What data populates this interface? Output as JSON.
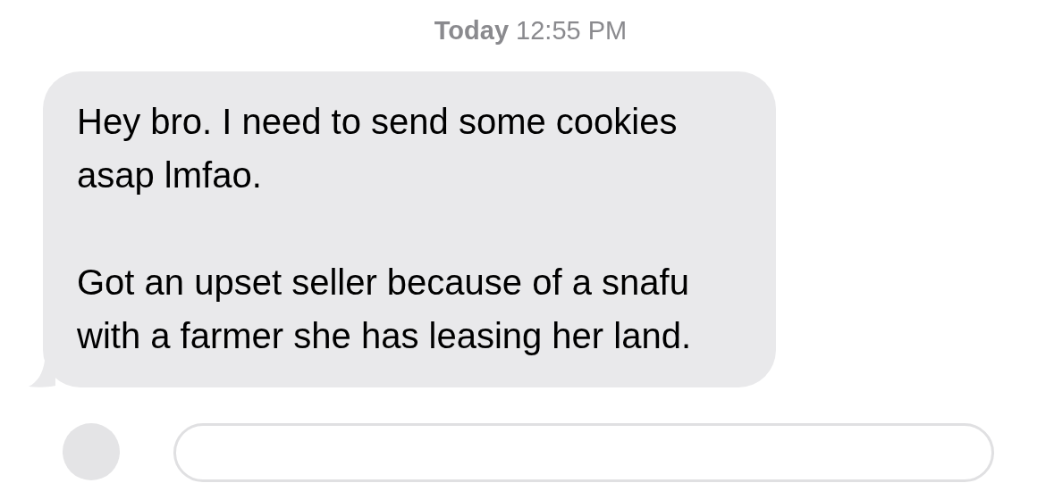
{
  "timestamp": "**Today** 12:55 PM",
  "message": {
    "paragraphs": [
      "Hey bro. I need to send some cookies asap lmfao.",
      "Got an upset seller because of a snafu with a farmer she has leasing her land."
    ]
  }
}
